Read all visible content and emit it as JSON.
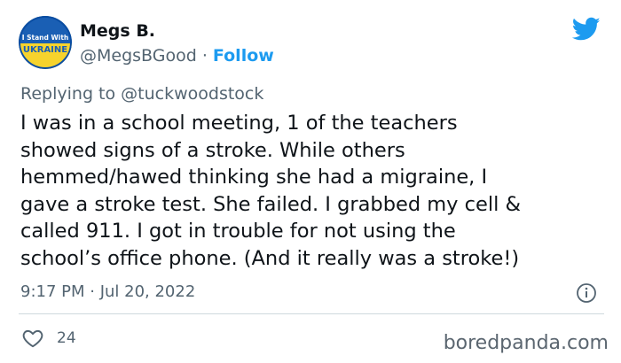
{
  "author": {
    "name": "Megs B.",
    "handle": "@MegsBGood",
    "separator": "·",
    "follow_label": "Follow",
    "avatar_text": [
      "I Stand With",
      "UKRAINE"
    ],
    "avatar_colors": {
      "top": "#1a5fb4",
      "bottom": "#f6d32d",
      "ring": "#0057b7"
    }
  },
  "reply": {
    "prefix": "Replying to",
    "handle": "@tuckwoodstock"
  },
  "tweet": {
    "lines": [
      "I was in a school meeting, 1 of the teachers",
      "showed signs of a stroke. While others",
      "hemmed/hawed thinking she had a migraine, I",
      "gave a stroke test. She failed. I grabbed my cell &",
      "called 911. I got in trouble for not using the",
      "school’s office phone. (And it really was a stroke!)"
    ],
    "timestamp": "9:17 PM · Jul 20, 2022",
    "likes": "24"
  },
  "icons": {
    "brand": "twitter-bird-icon",
    "info": "info-icon",
    "like": "heart-icon"
  },
  "watermark": "boredpanda.com",
  "colors": {
    "accent": "#1d9bf0",
    "muted": "#536471",
    "text": "#0f1419"
  }
}
